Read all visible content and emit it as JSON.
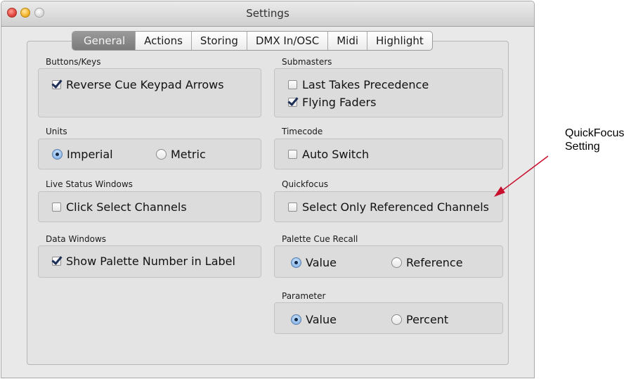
{
  "window": {
    "title": "Settings"
  },
  "tabs": [
    {
      "label": "General"
    },
    {
      "label": "Actions"
    },
    {
      "label": "Storing"
    },
    {
      "label": "DMX In/OSC"
    },
    {
      "label": "Midi"
    },
    {
      "label": "Highlight"
    }
  ],
  "left": {
    "buttons_keys": {
      "label": "Buttons/Keys",
      "reverse_cue": {
        "label": "Reverse Cue Keypad Arrows",
        "checked": true
      }
    },
    "units": {
      "label": "Units",
      "imperial": {
        "label": "Imperial",
        "selected": true
      },
      "metric": {
        "label": "Metric",
        "selected": false
      }
    },
    "live_status": {
      "label": "Live Status Windows",
      "click_select": {
        "label": "Click Select Channels",
        "checked": false
      }
    },
    "data_windows": {
      "label": "Data Windows",
      "show_palette": {
        "label": "Show Palette Number in Label",
        "checked": true
      }
    }
  },
  "right": {
    "submasters": {
      "label": "Submasters",
      "last_takes": {
        "label": "Last Takes Precedence",
        "checked": false
      },
      "flying_faders": {
        "label": "Flying Faders",
        "checked": true
      }
    },
    "timecode": {
      "label": "Timecode",
      "auto_switch": {
        "label": "Auto Switch",
        "checked": false
      }
    },
    "quickfocus": {
      "label": "Quickfocus",
      "select_only": {
        "label": "Select Only Referenced Channels",
        "checked": false
      }
    },
    "palette_cue_recall": {
      "label": "Palette Cue Recall",
      "value": {
        "label": "Value",
        "selected": true
      },
      "reference": {
        "label": "Reference",
        "selected": false
      }
    },
    "parameter": {
      "label": "Parameter",
      "value": {
        "label": "Value",
        "selected": true
      },
      "percent": {
        "label": "Percent",
        "selected": false
      }
    }
  },
  "annotation": {
    "line1": "QuickFocus",
    "line2": "Setting"
  }
}
